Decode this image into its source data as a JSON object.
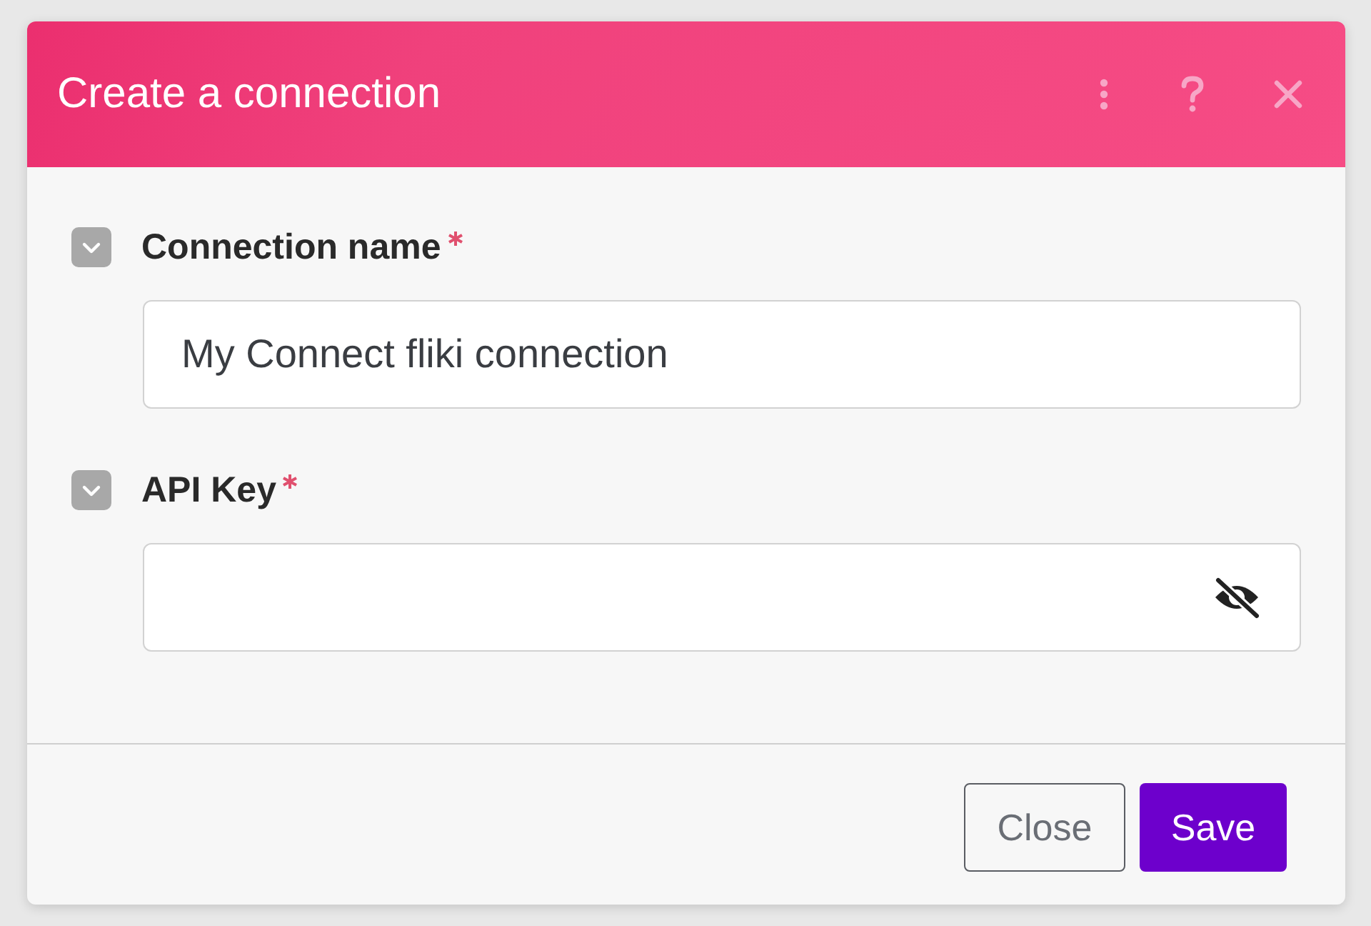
{
  "dialog": {
    "title": "Create a connection",
    "fields": [
      {
        "kind": "text",
        "label": "Connection name",
        "required": true,
        "expanded": true,
        "value": "My Connect fliki connection"
      },
      {
        "kind": "password",
        "label": "API Key",
        "required": true,
        "expanded": true
      }
    ],
    "buttons": [
      {
        "kind": "secondary",
        "label": "Close"
      },
      {
        "kind": "primary",
        "label": "Save"
      }
    ]
  }
}
